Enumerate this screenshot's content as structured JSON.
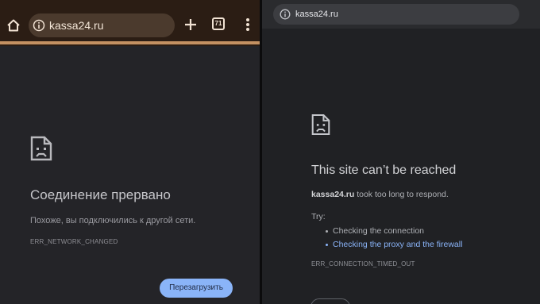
{
  "left": {
    "toolbar": {
      "url": "kassa24.ru",
      "tab_count": "71",
      "icons": [
        "home-icon",
        "info-icon",
        "plus-icon",
        "tabs-icon",
        "menu-icon"
      ]
    },
    "error": {
      "title": "Соединение прервано",
      "description": "Похоже, вы подключились к другой сети.",
      "code": "ERR_NETWORK_CHANGED",
      "reload_label": "Перезагрузить"
    }
  },
  "right": {
    "toolbar": {
      "url": "kassa24.ru"
    },
    "error": {
      "title": "This site can’t be reached",
      "host": "kassa24.ru",
      "message": " took too long to respond.",
      "try_label": "Try:",
      "suggestions": [
        "Checking the connection",
        "Checking the proxy and the firewall"
      ],
      "code": "ERR_CONNECTION_TIMED_OUT"
    }
  },
  "colors": {
    "accent_blue": "#8ab4f8",
    "mobile_toolbar": "#2b1d14",
    "page_background": "#202124"
  }
}
